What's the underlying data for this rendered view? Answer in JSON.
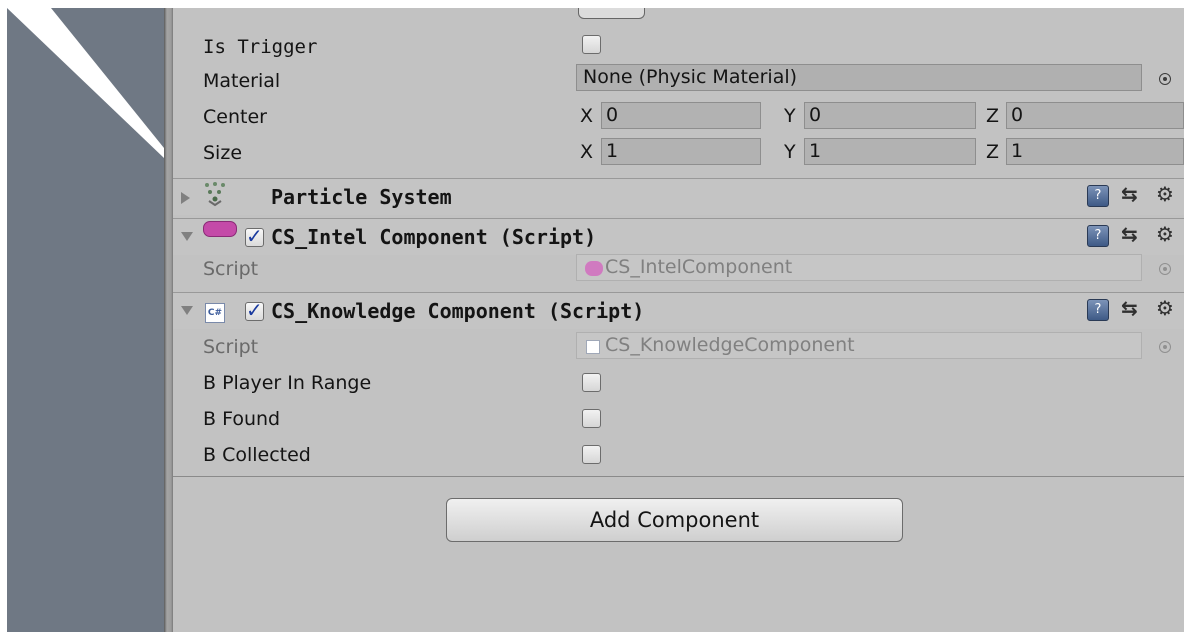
{
  "box_collider": {
    "is_trigger_label": "Is Trigger",
    "is_trigger": false,
    "material_label": "Material",
    "material_value": "None (Physic Material)",
    "center_label": "Center",
    "center": {
      "x_axis": "X",
      "x": "0",
      "y_axis": "Y",
      "y": "0",
      "z_axis": "Z",
      "z": "0"
    },
    "size_label": "Size",
    "size": {
      "x_axis": "X",
      "x": "1",
      "y_axis": "Y",
      "y": "1",
      "z_axis": "Z",
      "z": "1"
    }
  },
  "particle_system": {
    "title": "Particle System",
    "icon": "particle-system-icon",
    "expanded": false
  },
  "intel_component": {
    "title": "CS_Intel Component (Script)",
    "enabled": true,
    "icon": "script-capsule-icon",
    "script_label": "Script",
    "script_value": "CS_IntelComponent",
    "icon_color": "#c44aa8"
  },
  "knowledge_component": {
    "title": "CS_Knowledge Component (Script)",
    "enabled": true,
    "icon": "csharp-script-icon",
    "script_label": "Script",
    "script_value": "CS_KnowledgeComponent",
    "fields": [
      {
        "label": "B Player In Range",
        "value": false
      },
      {
        "label": "B Found",
        "value": false
      },
      {
        "label": "B Collected",
        "value": false
      }
    ]
  },
  "add_component_label": "Add Component",
  "colors": {
    "inspector_bg": "#c2c2c2",
    "scene_bg": "#6f7884",
    "checkmark": "#1a3a9e"
  }
}
